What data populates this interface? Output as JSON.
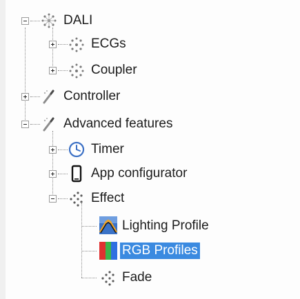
{
  "tree": {
    "dali": "DALI",
    "ecgs": "ECGs",
    "coupler": "Coupler",
    "controller": "Controller",
    "advanced_features": "Advanced features",
    "timer": "Timer",
    "app_configurator": "App configurator",
    "effect": "Effect",
    "lighting_profile": "Lighting Profile",
    "rgb_profiles": "RGB Profiles",
    "fade": "Fade"
  },
  "selected_item": "RGB Profiles",
  "colors": {
    "selection": "#3b8ae0"
  },
  "icons": {
    "dali": "dali-network-icon",
    "ecgs": "dali-network-icon",
    "coupler": "dali-network-icon",
    "controller": "wand-icon",
    "advanced_features": "wand-icon",
    "timer": "clock-icon",
    "app_configurator": "phone-icon",
    "effect": "dots-icon",
    "lighting_profile": "lighting-profile-icon",
    "rgb_profiles": "rgb-icon",
    "fade": "dots-icon"
  }
}
